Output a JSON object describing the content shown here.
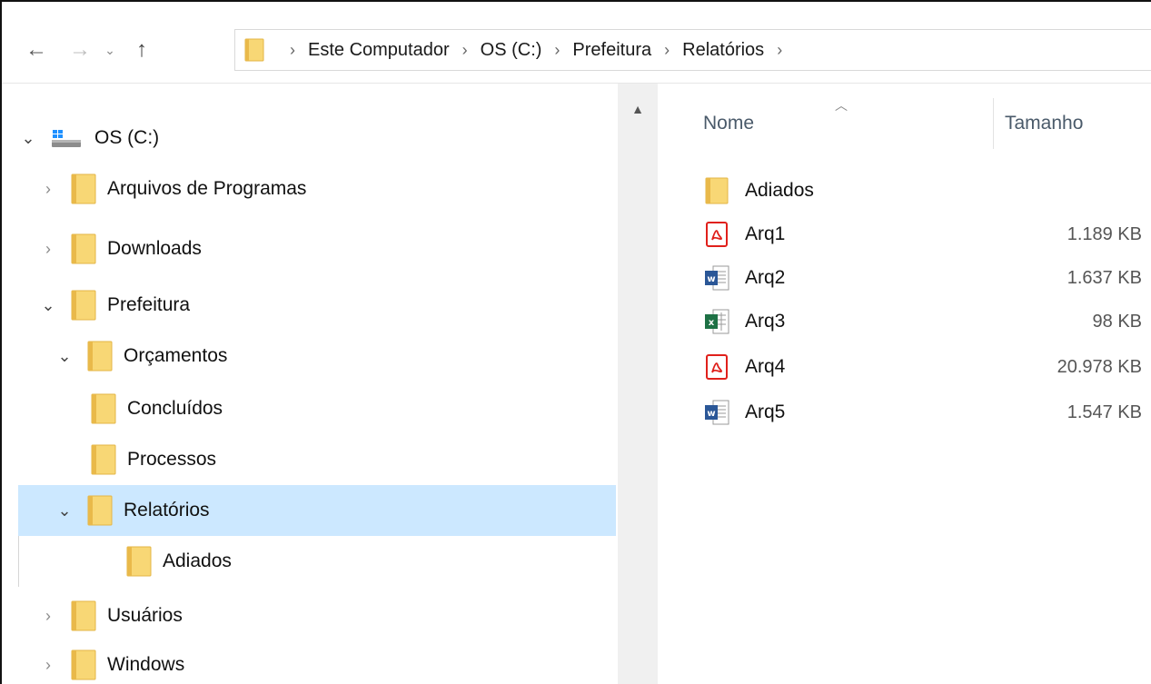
{
  "address": {
    "crumbs": [
      "Este Computador",
      "OS (C:)",
      "Prefeitura",
      "Relatórios"
    ]
  },
  "tree": {
    "drive": "OS (C:)",
    "items": [
      {
        "label": "Arquivos de Programas",
        "state": "collapsed",
        "level": 1
      },
      {
        "label": "Downloads",
        "state": "collapsed",
        "level": 1
      },
      {
        "label": "Prefeitura",
        "state": "expanded",
        "level": 1
      },
      {
        "label": "Orçamentos",
        "state": "expanded",
        "level": 2
      },
      {
        "label": "Concluídos",
        "state": "none",
        "level": 3
      },
      {
        "label": "Processos",
        "state": "none",
        "level": 2
      },
      {
        "label": "Relatórios",
        "state": "expanded",
        "level": 2,
        "selected": true
      },
      {
        "label": "Adiados",
        "state": "none",
        "level": 3
      },
      {
        "label": "Usuários",
        "state": "collapsed",
        "level": 1
      },
      {
        "label": "Windows",
        "state": "collapsed",
        "level": 1
      }
    ]
  },
  "list": {
    "columns": {
      "name": "Nome",
      "size": "Tamanho"
    },
    "files": [
      {
        "name": "Adiados",
        "size": "",
        "icon": "folder-icon"
      },
      {
        "name": "Arq1",
        "size": "1.189 KB",
        "icon": "pdf-file-icon"
      },
      {
        "name": "Arq2",
        "size": "1.637 KB",
        "icon": "word-file-icon"
      },
      {
        "name": "Arq3",
        "size": "98 KB",
        "icon": "excel-file-icon"
      },
      {
        "name": "Arq4",
        "size": "20.978 KB",
        "icon": "pdf-file-icon"
      },
      {
        "name": "Arq5",
        "size": "1.547 KB",
        "icon": "word-file-icon"
      }
    ]
  },
  "colors": {
    "selection": "#cce8ff",
    "folder": "#f8d775",
    "pdf": "#e0201b",
    "word": "#2b5797",
    "excel": "#1e7145"
  }
}
